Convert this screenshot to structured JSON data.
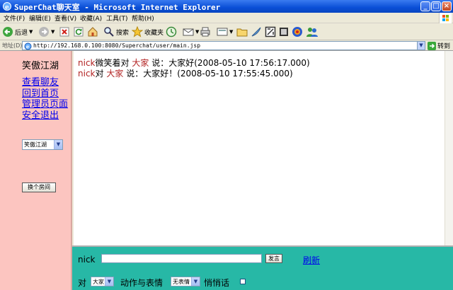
{
  "window": {
    "title": "SuperChat聊天室 - Microsoft Internet Explorer",
    "buttons": {
      "minimize": "_",
      "maximize": "□",
      "close": "×"
    }
  },
  "menu": {
    "items": [
      "文件(F)",
      "编辑(E)",
      "查看(V)",
      "收藏(A)",
      "工具(T)",
      "帮助(H)"
    ]
  },
  "toolbar": {
    "back_label": "后退",
    "search_label": "搜索",
    "favorites_label": "收藏夹"
  },
  "address": {
    "label": "地址(D)",
    "url": "http://192.168.0.100:8080/Superchat/user/main.jsp",
    "go_label": "转到"
  },
  "sidebar": {
    "title": "笑傲江湖",
    "links": [
      "查看聊友",
      "回到首页",
      "管理员页面",
      "安全退出"
    ],
    "room_select": "笑傲江湖",
    "change_room_button": "换个房间"
  },
  "messages": [
    {
      "sender": "nick",
      "verb": "微笑着对",
      "target": "大家",
      "text": "说：大家好(2008-05-10 17:56:17.000)"
    },
    {
      "sender": "nick",
      "verb": "对",
      "target": "大家",
      "text": "说：大家好！(2008-05-10 17:55:45.000)"
    }
  ],
  "compose": {
    "nickname": "nick",
    "message_value": "",
    "send_button": "发言",
    "refresh_link": "刷新",
    "to_label": "对",
    "to_select": "大家",
    "action_label": "动作与表情",
    "action_select": "无表情",
    "whisper_label": "悄悄话",
    "whisper_checked": false
  },
  "colors": {
    "titlebar": "#0a4ed6",
    "left_frame": "#fcc5c0",
    "compose_frame": "#27b8a6",
    "message_highlight": "#b22222",
    "link": "#0000ee"
  }
}
